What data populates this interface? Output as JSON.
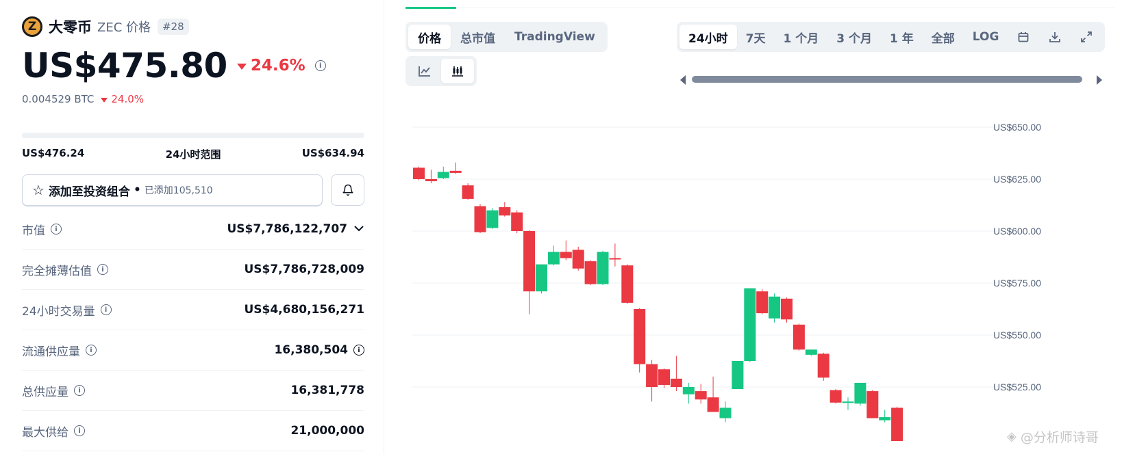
{
  "coin": {
    "logo_letter": "Z",
    "name": "大零币",
    "symbol_label": "ZEC 价格",
    "rank": "#28",
    "price": "US$475.80",
    "price_change": "24.6%",
    "btc_price": "0.004529 BTC",
    "btc_change": "24.0%",
    "change_color": "#ea3943"
  },
  "range": {
    "low": "US$476.24",
    "label": "24小时范围",
    "high": "US$634.94",
    "current_position": 0.0
  },
  "portfolio": {
    "label": "添加至投资组合",
    "added_text": "已添加105,510"
  },
  "stats": [
    {
      "name": "市值",
      "value": "US$7,786,122,707"
    },
    {
      "name": "完全摊薄估值",
      "value": "US$7,786,728,009"
    },
    {
      "name": "24小时交易量",
      "value": "US$4,680,156,271"
    },
    {
      "name": "流通供应量",
      "value": "16,380,504"
    },
    {
      "name": "总供应量",
      "value": "16,381,778"
    },
    {
      "name": "最大供给",
      "value": "21,000,000"
    }
  ],
  "chart_tabs": [
    "价格",
    "总市值",
    "TradingView"
  ],
  "chart_type_icons": [
    "line-chart-icon",
    "candlestick-icon"
  ],
  "range_tabs": [
    "24小时",
    "7天",
    "1 个月",
    "3 个月",
    "1 年",
    "全部",
    "LOG"
  ],
  "range_icons": [
    "calendar-icon",
    "download-icon",
    "fullscreen-icon"
  ],
  "colors": {
    "up": "#16c784",
    "down": "#ea3943",
    "grid": "#eff2f5",
    "axis_text": "#58667e"
  },
  "chart_data": {
    "type": "candlestick",
    "y_ticks": [
      "US$650.00",
      "US$625.00",
      "US$600.00",
      "US$575.00",
      "US$550.00",
      "US$525.00"
    ],
    "ylim": [
      500,
      655
    ],
    "grid": true,
    "candles": [
      {
        "o": 630.5,
        "h": 631.0,
        "l": 624.5,
        "c": 625.0
      },
      {
        "o": 625.0,
        "h": 629.5,
        "l": 623.0,
        "c": 624.0
      },
      {
        "o": 625.5,
        "h": 631.0,
        "l": 625.0,
        "c": 628.5
      },
      {
        "o": 629.0,
        "h": 633.0,
        "l": 627.5,
        "c": 628.0
      },
      {
        "o": 622.0,
        "h": 623.0,
        "l": 615.0,
        "c": 615.5
      },
      {
        "o": 612.0,
        "h": 613.0,
        "l": 599.0,
        "c": 599.5
      },
      {
        "o": 601.5,
        "h": 611.0,
        "l": 601.0,
        "c": 610.0
      },
      {
        "o": 611.5,
        "h": 614.0,
        "l": 607.0,
        "c": 607.5
      },
      {
        "o": 609.0,
        "h": 610.0,
        "l": 599.0,
        "c": 600.0
      },
      {
        "o": 600.0,
        "h": 600.5,
        "l": 560.0,
        "c": 571.0
      },
      {
        "o": 571.0,
        "h": 584.0,
        "l": 570.0,
        "c": 584.0
      },
      {
        "o": 584.0,
        "h": 593.0,
        "l": 583.5,
        "c": 590.0
      },
      {
        "o": 590.0,
        "h": 595.5,
        "l": 586.0,
        "c": 587.0
      },
      {
        "o": 591.0,
        "h": 592.5,
        "l": 581.0,
        "c": 582.0
      },
      {
        "o": 585.5,
        "h": 586.0,
        "l": 574.0,
        "c": 574.5
      },
      {
        "o": 574.5,
        "h": 590.5,
        "l": 574.0,
        "c": 590.0
      },
      {
        "o": 587.0,
        "h": 594.0,
        "l": 583.0,
        "c": 586.5
      },
      {
        "o": 583.5,
        "h": 584.0,
        "l": 565.0,
        "c": 565.5
      },
      {
        "o": 562.5,
        "h": 563.0,
        "l": 532.0,
        "c": 536.0
      },
      {
        "o": 536.0,
        "h": 538.0,
        "l": 518.0,
        "c": 525.0
      },
      {
        "o": 533.5,
        "h": 534.0,
        "l": 524.5,
        "c": 526.0
      },
      {
        "o": 529.0,
        "h": 540.0,
        "l": 523.0,
        "c": 525.0
      },
      {
        "o": 521.5,
        "h": 527.0,
        "l": 517.0,
        "c": 525.0
      },
      {
        "o": 523.0,
        "h": 526.5,
        "l": 517.0,
        "c": 519.0
      },
      {
        "o": 520.0,
        "h": 530.0,
        "l": 514.0,
        "c": 513.0
      },
      {
        "o": 510.0,
        "h": 518.0,
        "l": 508.0,
        "c": 515.0
      },
      {
        "o": 524.0,
        "h": 537.5,
        "l": 524.0,
        "c": 537.5
      },
      {
        "o": 537.5,
        "h": 572.5,
        "l": 537.0,
        "c": 572.5
      },
      {
        "o": 571.0,
        "h": 572.0,
        "l": 560.0,
        "c": 560.5
      },
      {
        "o": 558.0,
        "h": 570.0,
        "l": 556.0,
        "c": 568.5
      },
      {
        "o": 567.5,
        "h": 568.0,
        "l": 556.0,
        "c": 557.5
      },
      {
        "o": 555.0,
        "h": 555.5,
        "l": 542.5,
        "c": 543.0
      },
      {
        "o": 540.5,
        "h": 543.0,
        "l": 540.0,
        "c": 543.0
      },
      {
        "o": 541.0,
        "h": 541.5,
        "l": 528.0,
        "c": 529.5
      },
      {
        "o": 523.5,
        "h": 524.0,
        "l": 517.0,
        "c": 517.5
      },
      {
        "o": 517.5,
        "h": 520.0,
        "l": 514.0,
        "c": 518.0
      },
      {
        "o": 517.0,
        "h": 527.0,
        "l": 516.0,
        "c": 527.0
      },
      {
        "o": 523.0,
        "h": 523.5,
        "l": 510.0,
        "c": 510.0
      },
      {
        "o": 509.0,
        "h": 514.0,
        "l": 508.0,
        "c": 510.5
      },
      {
        "o": 515.0,
        "h": 515.5,
        "l": 499.0,
        "c": 499.0
      }
    ]
  },
  "watermark": "@分析师诗哥"
}
